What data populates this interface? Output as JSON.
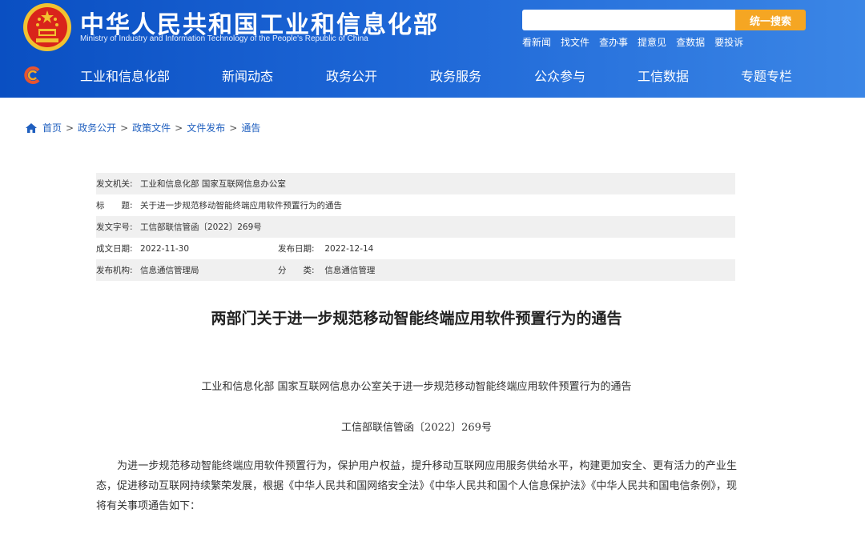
{
  "header": {
    "title": "中华人民共和国工业和信息化部",
    "subtitle": "Ministry of Industry and Information Technology of the People's Republic of China",
    "search_placeholder": "",
    "search_button": "统一搜索",
    "quick_links": [
      "看新闻",
      "找文件",
      "查办事",
      "提意见",
      "查数据",
      "要投诉"
    ]
  },
  "nav": {
    "items": [
      "工业和信息化部",
      "新闻动态",
      "政务公开",
      "政务服务",
      "公众参与",
      "工信数据",
      "专题专栏"
    ]
  },
  "breadcrumb": [
    "首页",
    "政务公开",
    "政策文件",
    "文件发布",
    "通告"
  ],
  "meta": {
    "issuer_label": "发文机关:",
    "issuer": "工业和信息化部 国家互联网信息办公室",
    "title_label": "标　　题:",
    "title": "关于进一步规范移动智能终端应用软件预置行为的通告",
    "docno_label": "发文字号:",
    "docno": "工信部联信管函〔2022〕269号",
    "created_label": "成文日期:",
    "created": "2022-11-30",
    "published_label": "发布日期:",
    "published": "2022-12-14",
    "org_label": "发布机构:",
    "org": "信息通信管理局",
    "category_label": "分　　类:",
    "category": "信息通信管理"
  },
  "article": {
    "title": "两部门关于进一步规范移动智能终端应用软件预置行为的通告",
    "heading": "工业和信息化部 国家互联网信息办公室关于进一步规范移动智能终端应用软件预置行为的通告",
    "doc_number": "工信部联信管函〔2022〕269号",
    "paragraph": "为进一步规范移动智能终端应用软件预置行为，保护用户权益，提升移动互联网应用服务供给水平，构建更加安全、更有活力的产业生态，促进移动互联网持续繁荣发展，根据《中华人民共和国网络安全法》《中华人民共和国个人信息保护法》《中华人民共和国电信条例》，现将有关事项通告如下："
  },
  "colors": {
    "header_blue": "#1d66d6",
    "search_orange": "#f5a623",
    "link_blue": "#1f5fbf"
  }
}
